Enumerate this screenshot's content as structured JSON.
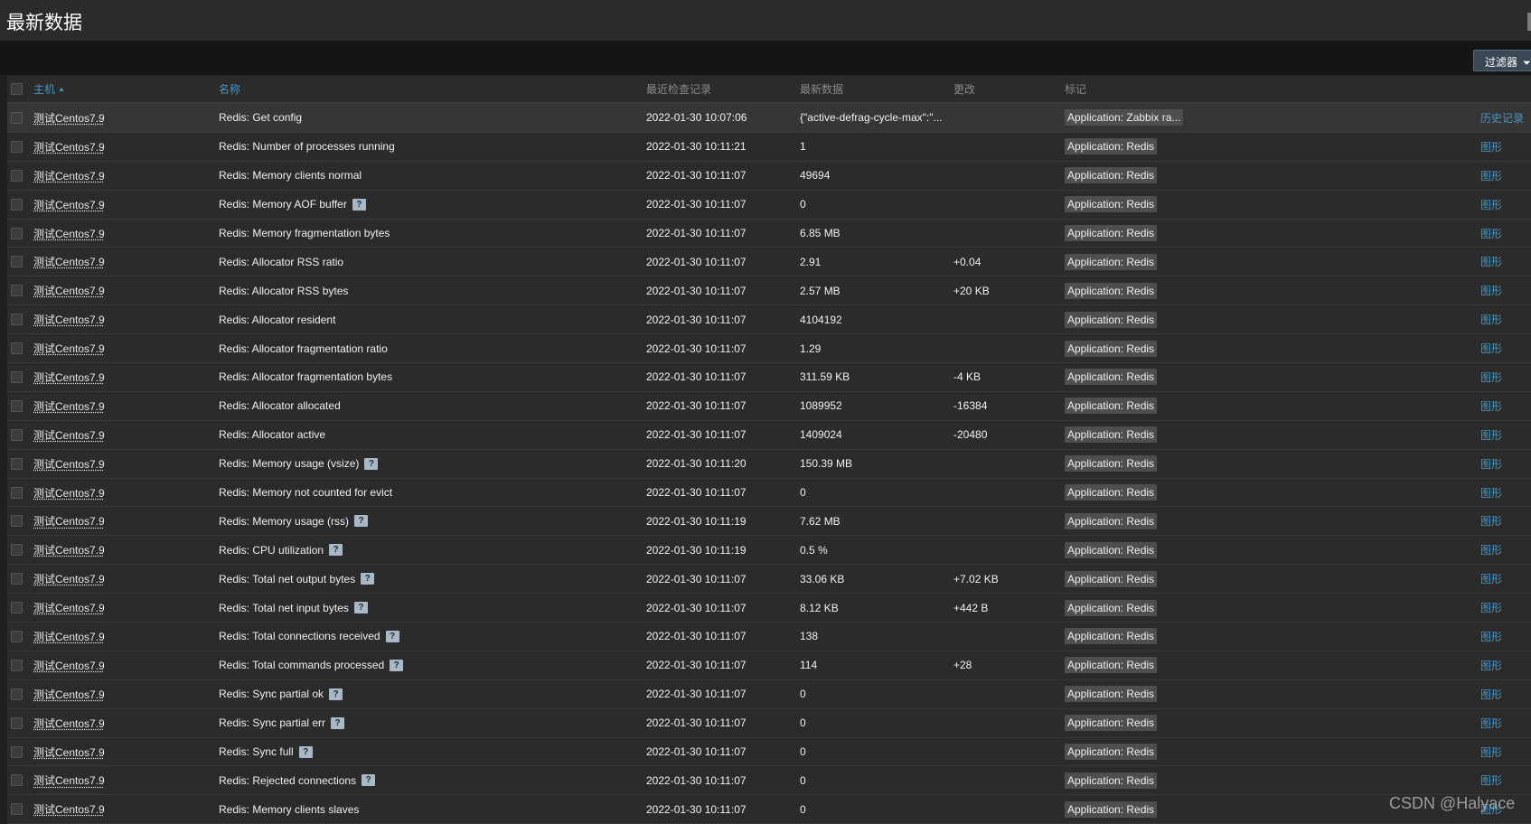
{
  "page": {
    "title": "最新数据"
  },
  "filter": {
    "label": "过滤器",
    "icon": "funnel-icon"
  },
  "columns": {
    "host": "主机",
    "name": "名称",
    "last_check": "最近检查记录",
    "last_value": "最新数据",
    "change": "更改",
    "tags": "标记",
    "sort_indicator": "▲"
  },
  "rows": [
    {
      "host": "测试Centos7.9",
      "name": "Redis: Get config",
      "help": false,
      "time": "2022-01-30 10:07:06",
      "value": "{\"active-defrag-cycle-max\":\"...",
      "change": "",
      "tag": "Application: Zabbix ra...",
      "action": "历史记录"
    },
    {
      "host": "测试Centos7.9",
      "name": "Redis: Number of processes running",
      "help": false,
      "time": "2022-01-30 10:11:21",
      "value": "1",
      "change": "",
      "tag": "Application: Redis",
      "action": "图形"
    },
    {
      "host": "测试Centos7.9",
      "name": "Redis: Memory clients normal",
      "help": false,
      "time": "2022-01-30 10:11:07",
      "value": "49694",
      "change": "",
      "tag": "Application: Redis",
      "action": "图形"
    },
    {
      "host": "测试Centos7.9",
      "name": "Redis: Memory AOF buffer",
      "help": true,
      "time": "2022-01-30 10:11:07",
      "value": "0",
      "change": "",
      "tag": "Application: Redis",
      "action": "图形"
    },
    {
      "host": "测试Centos7.9",
      "name": "Redis: Memory fragmentation bytes",
      "help": false,
      "time": "2022-01-30 10:11:07",
      "value": "6.85 MB",
      "change": "",
      "tag": "Application: Redis",
      "action": "图形"
    },
    {
      "host": "测试Centos7.9",
      "name": "Redis: Allocator RSS ratio",
      "help": false,
      "time": "2022-01-30 10:11:07",
      "value": "2.91",
      "change": "+0.04",
      "tag": "Application: Redis",
      "action": "图形"
    },
    {
      "host": "测试Centos7.9",
      "name": "Redis: Allocator RSS bytes",
      "help": false,
      "time": "2022-01-30 10:11:07",
      "value": "2.57 MB",
      "change": "+20 KB",
      "tag": "Application: Redis",
      "action": "图形"
    },
    {
      "host": "测试Centos7.9",
      "name": "Redis: Allocator resident",
      "help": false,
      "time": "2022-01-30 10:11:07",
      "value": "4104192",
      "change": "",
      "tag": "Application: Redis",
      "action": "图形"
    },
    {
      "host": "测试Centos7.9",
      "name": "Redis: Allocator fragmentation ratio",
      "help": false,
      "time": "2022-01-30 10:11:07",
      "value": "1.29",
      "change": "",
      "tag": "Application: Redis",
      "action": "图形"
    },
    {
      "host": "测试Centos7.9",
      "name": "Redis: Allocator fragmentation bytes",
      "help": false,
      "time": "2022-01-30 10:11:07",
      "value": "311.59 KB",
      "change": "-4 KB",
      "tag": "Application: Redis",
      "action": "图形"
    },
    {
      "host": "测试Centos7.9",
      "name": "Redis: Allocator allocated",
      "help": false,
      "time": "2022-01-30 10:11:07",
      "value": "1089952",
      "change": "-16384",
      "tag": "Application: Redis",
      "action": "图形"
    },
    {
      "host": "测试Centos7.9",
      "name": "Redis: Allocator active",
      "help": false,
      "time": "2022-01-30 10:11:07",
      "value": "1409024",
      "change": "-20480",
      "tag": "Application: Redis",
      "action": "图形"
    },
    {
      "host": "测试Centos7.9",
      "name": "Redis: Memory usage (vsize)",
      "help": true,
      "time": "2022-01-30 10:11:20",
      "value": "150.39 MB",
      "change": "",
      "tag": "Application: Redis",
      "action": "图形"
    },
    {
      "host": "测试Centos7.9",
      "name": "Redis: Memory not counted for evict",
      "help": false,
      "time": "2022-01-30 10:11:07",
      "value": "0",
      "change": "",
      "tag": "Application: Redis",
      "action": "图形"
    },
    {
      "host": "测试Centos7.9",
      "name": "Redis: Memory usage (rss)",
      "help": true,
      "time": "2022-01-30 10:11:19",
      "value": "7.62 MB",
      "change": "",
      "tag": "Application: Redis",
      "action": "图形"
    },
    {
      "host": "测试Centos7.9",
      "name": "Redis: CPU utilization",
      "help": true,
      "time": "2022-01-30 10:11:19",
      "value": "0.5 %",
      "change": "",
      "tag": "Application: Redis",
      "action": "图形"
    },
    {
      "host": "测试Centos7.9",
      "name": "Redis: Total net output bytes",
      "help": true,
      "time": "2022-01-30 10:11:07",
      "value": "33.06 KB",
      "change": "+7.02 KB",
      "tag": "Application: Redis",
      "action": "图形"
    },
    {
      "host": "测试Centos7.9",
      "name": "Redis: Total net input bytes",
      "help": true,
      "time": "2022-01-30 10:11:07",
      "value": "8.12 KB",
      "change": "+442 B",
      "tag": "Application: Redis",
      "action": "图形"
    },
    {
      "host": "测试Centos7.9",
      "name": "Redis: Total connections received",
      "help": true,
      "time": "2022-01-30 10:11:07",
      "value": "138",
      "change": "",
      "tag": "Application: Redis",
      "action": "图形"
    },
    {
      "host": "测试Centos7.9",
      "name": "Redis: Total commands processed",
      "help": true,
      "time": "2022-01-30 10:11:07",
      "value": "114",
      "change": "+28",
      "tag": "Application: Redis",
      "action": "图形"
    },
    {
      "host": "测试Centos7.9",
      "name": "Redis: Sync partial ok",
      "help": true,
      "time": "2022-01-30 10:11:07",
      "value": "0",
      "change": "",
      "tag": "Application: Redis",
      "action": "图形"
    },
    {
      "host": "测试Centos7.9",
      "name": "Redis: Sync partial err",
      "help": true,
      "time": "2022-01-30 10:11:07",
      "value": "0",
      "change": "",
      "tag": "Application: Redis",
      "action": "图形"
    },
    {
      "host": "测试Centos7.9",
      "name": "Redis: Sync full",
      "help": true,
      "time": "2022-01-30 10:11:07",
      "value": "0",
      "change": "",
      "tag": "Application: Redis",
      "action": "图形"
    },
    {
      "host": "测试Centos7.9",
      "name": "Redis: Rejected connections",
      "help": true,
      "time": "2022-01-30 10:11:07",
      "value": "0",
      "change": "",
      "tag": "Application: Redis",
      "action": "图形"
    },
    {
      "host": "测试Centos7.9",
      "name": "Redis: Memory clients slaves",
      "help": false,
      "time": "2022-01-30 10:11:07",
      "value": "0",
      "change": "",
      "tag": "Application: Redis",
      "action": "图形"
    }
  ],
  "help_icon": {
    "glyph": "?",
    "icon": "help-icon"
  },
  "watermark": "CSDN @Halyace",
  "colors": {
    "link": "#4796c4",
    "background": "#2b2b2b",
    "tag_bg": "#4e4e4e"
  }
}
